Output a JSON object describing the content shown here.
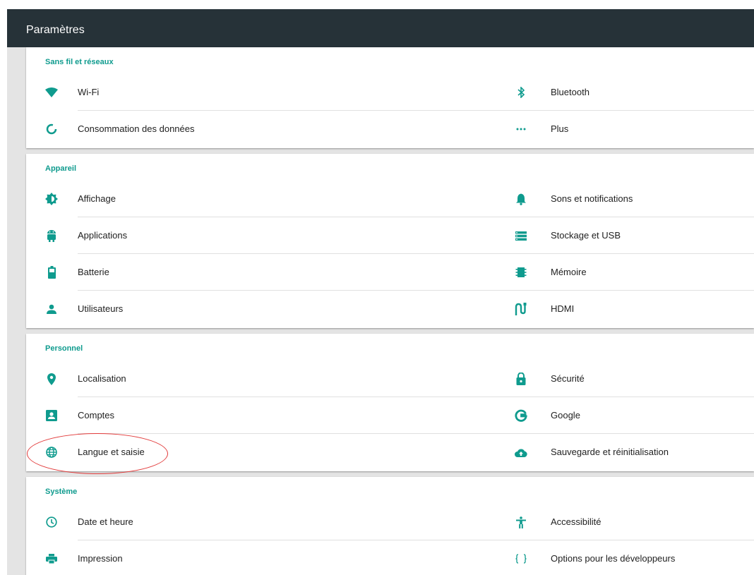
{
  "header": {
    "title": "Paramètres"
  },
  "accent_color": "#0f9b8e",
  "sections": [
    {
      "title": "Sans fil et réseaux",
      "left": [
        {
          "label": "Wi-Fi",
          "icon": "wifi-icon"
        },
        {
          "label": "Consommation des données",
          "icon": "data-usage-icon"
        }
      ],
      "right": [
        {
          "label": "Bluetooth",
          "icon": "bluetooth-icon"
        },
        {
          "label": "Plus",
          "icon": "more-icon"
        }
      ]
    },
    {
      "title": "Appareil",
      "left": [
        {
          "label": "Affichage",
          "icon": "brightness-icon"
        },
        {
          "label": "Applications",
          "icon": "android-icon"
        },
        {
          "label": "Batterie",
          "icon": "battery-icon"
        },
        {
          "label": "Utilisateurs",
          "icon": "person-icon"
        }
      ],
      "right": [
        {
          "label": "Sons et notifications",
          "icon": "bell-icon"
        },
        {
          "label": "Stockage et USB",
          "icon": "storage-icon"
        },
        {
          "label": "Mémoire",
          "icon": "memory-icon"
        },
        {
          "label": "HDMI",
          "icon": "hdmi-icon"
        }
      ]
    },
    {
      "title": "Personnel",
      "left": [
        {
          "label": "Localisation",
          "icon": "location-pin-icon"
        },
        {
          "label": "Comptes",
          "icon": "account-box-icon"
        },
        {
          "label": "Langue et saisie",
          "icon": "globe-icon"
        }
      ],
      "right": [
        {
          "label": "Sécurité",
          "icon": "lock-icon"
        },
        {
          "label": "Google",
          "icon": "google-icon"
        },
        {
          "label": "Sauvegarde et réinitialisation",
          "icon": "cloud-upload-icon"
        }
      ]
    },
    {
      "title": "Système",
      "left": [
        {
          "label": "Date et heure",
          "icon": "clock-icon"
        },
        {
          "label": "Impression",
          "icon": "printer-icon"
        }
      ],
      "right": [
        {
          "label": "Accessibilité",
          "icon": "accessibility-icon"
        },
        {
          "label": "Options pour les développeurs",
          "icon": "braces-icon"
        }
      ]
    }
  ]
}
